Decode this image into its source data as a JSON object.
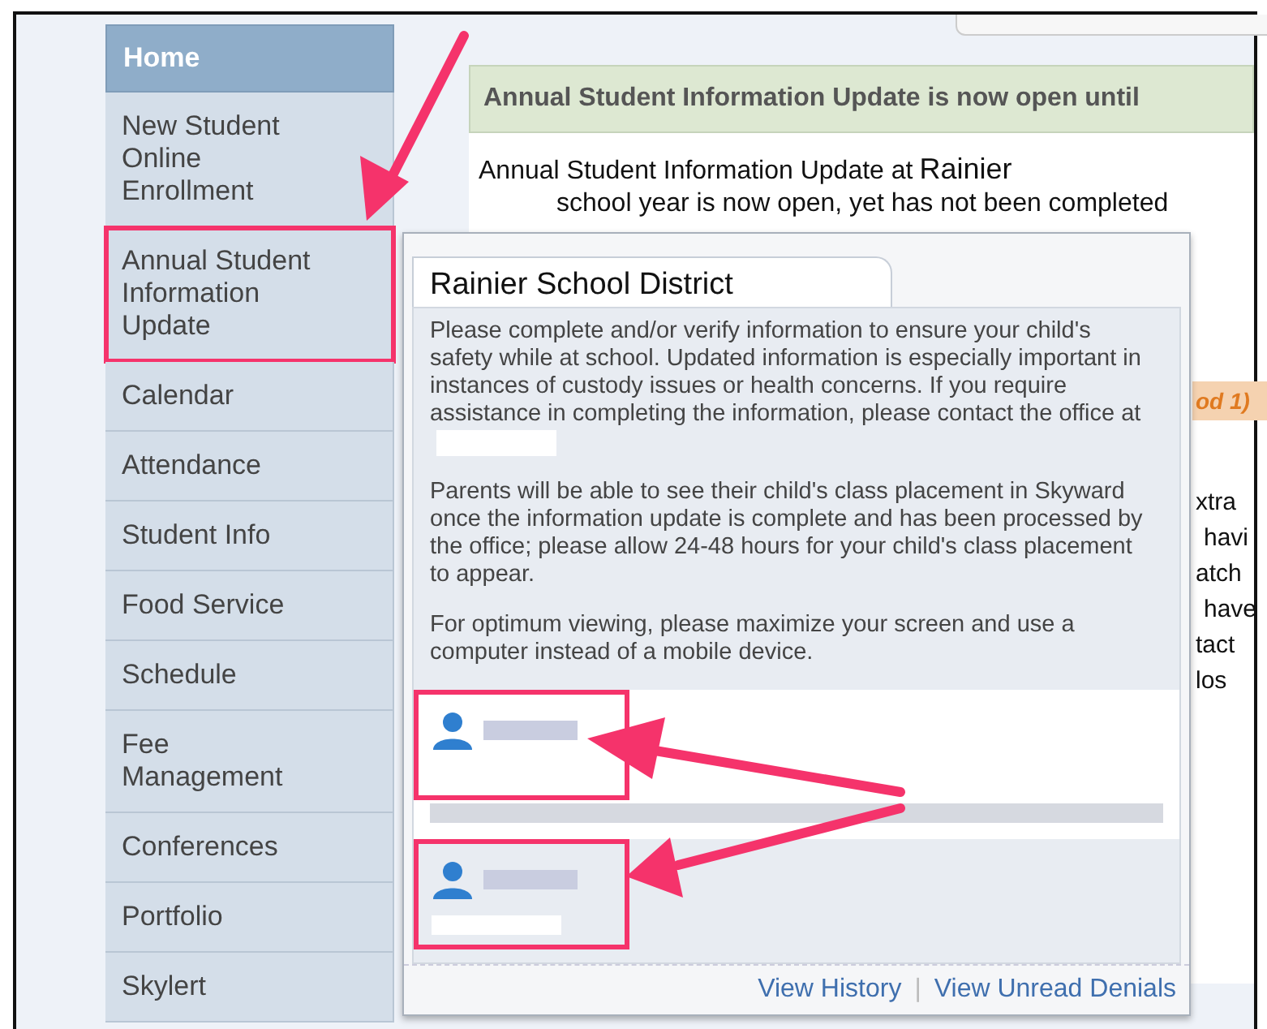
{
  "sidebar": {
    "items": [
      {
        "label": "Home",
        "selected": true,
        "callout": false
      },
      {
        "label": "New Student Online Enrollment",
        "selected": false,
        "callout": false
      },
      {
        "label": "Annual Student Information Update",
        "selected": false,
        "callout": true
      },
      {
        "label": "Calendar",
        "selected": false,
        "callout": false
      },
      {
        "label": "Attendance",
        "selected": false,
        "callout": false
      },
      {
        "label": "Student Info",
        "selected": false,
        "callout": false
      },
      {
        "label": "Food Service",
        "selected": false,
        "callout": false
      },
      {
        "label": "Schedule",
        "selected": false,
        "callout": false
      },
      {
        "label": "Fee Management",
        "selected": false,
        "callout": false
      },
      {
        "label": "Conferences",
        "selected": false,
        "callout": false
      },
      {
        "label": "Portfolio",
        "selected": false,
        "callout": false
      },
      {
        "label": "Skylert",
        "selected": false,
        "callout": false
      }
    ]
  },
  "main": {
    "header": "Annual Student Information Update is now open until",
    "message_start": "Annual Student Information Update at",
    "district_word": "Rainier",
    "message_line2": "school year is now open, yet has not been completed",
    "section_fragment": "od 1)",
    "text_fragments": [
      "xtra",
      "havi",
      "atch",
      "have",
      "tact",
      "los"
    ]
  },
  "popup": {
    "tab": "Rainier School District",
    "paragraphs": [
      "Please complete and/or verify information to ensure your child's safety while at school. Updated information is especially important in instances of custody issues or health concerns. If you require assistance in completing the information, please contact the office at",
      "Parents will be able to see their child's class placement in Skyward once the information update is complete and has been processed by the office; please allow 24-48 hours for your child's class placement to appear.",
      "For optimum viewing, please maximize your screen and use a computer instead of a mobile device."
    ],
    "contacts": [
      {
        "callout": true,
        "detail_line": true
      },
      {
        "callout": true,
        "detail_line": false
      }
    ],
    "links": [
      "View History",
      "View Unread Denials"
    ],
    "link_separator": "|"
  }
}
